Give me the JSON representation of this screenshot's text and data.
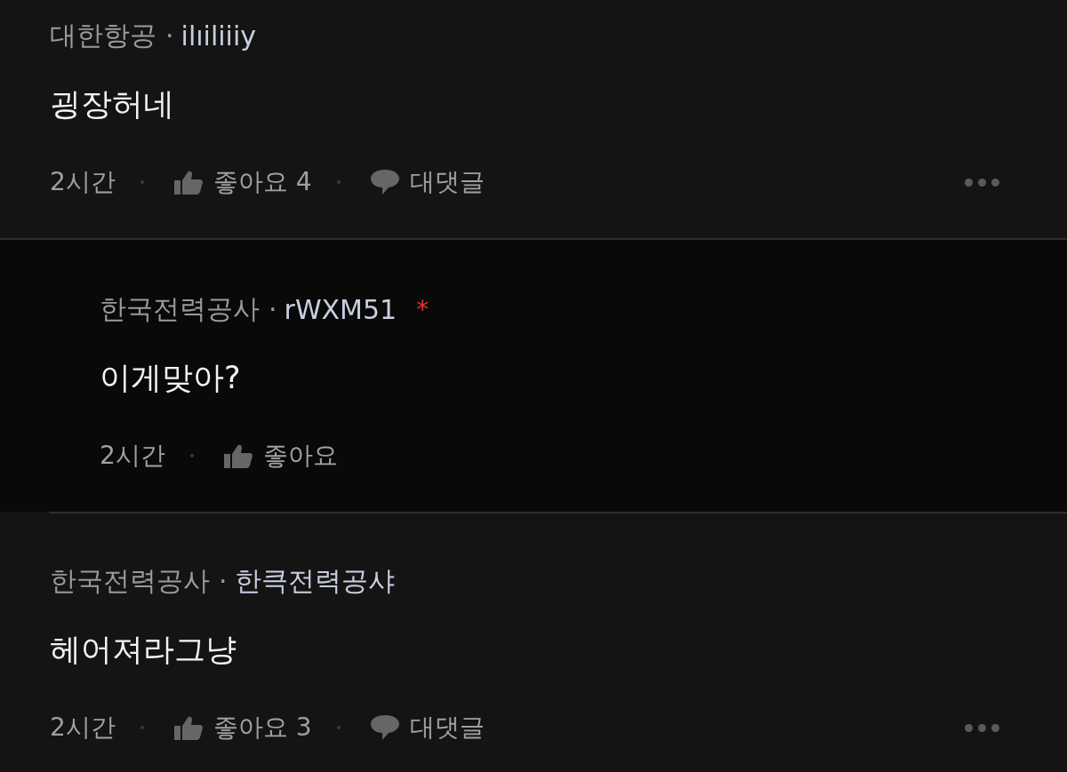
{
  "comments": [
    {
      "kind": "comment",
      "company": "대한항공",
      "separator": "·",
      "nickname": "ilıiliiiy",
      "body": "굉장허네",
      "time": "2시간",
      "like": "좋아요 4",
      "reply": "대댓글",
      "more": true
    },
    {
      "kind": "reply",
      "company": "한국전력공사",
      "separator": "·",
      "nickname": "rWXM51",
      "badge": "*",
      "body": "이게맞아?",
      "time": "2시간",
      "like": "좋아요",
      "more": false
    },
    {
      "kind": "comment",
      "company": "한국전력공사",
      "separator": "·",
      "nickname": "한큭전력공샤",
      "body": "헤어져라그냥",
      "time": "2시간",
      "like": "좋아요 3",
      "reply": "대댓글",
      "more": true
    }
  ]
}
